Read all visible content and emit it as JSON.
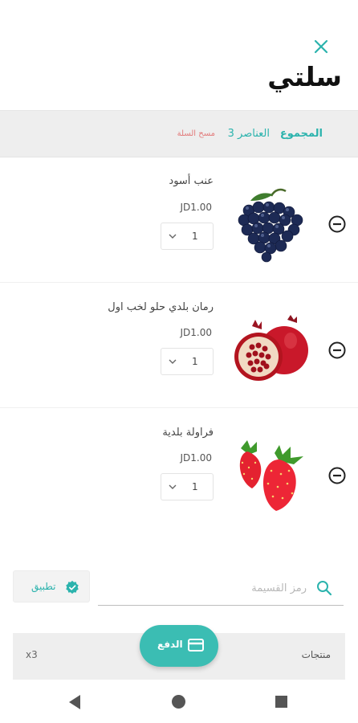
{
  "header": {
    "title": "سلتي"
  },
  "summary": {
    "total_label": "المجموع",
    "count_text": "3 العناصر",
    "clear_label": "مسح السلة"
  },
  "items": [
    {
      "name": "عنب أسود",
      "price": "JD1.00",
      "quantity": "1"
    },
    {
      "name": "رمان بلدي حلو لخب اول",
      "price": "JD1.00",
      "quantity": "1"
    },
    {
      "name": "فراولة بلدية",
      "price": "JD1.00",
      "quantity": "1"
    }
  ],
  "coupon": {
    "placeholder": "رمز القسيمة",
    "apply_label": "تطبيق"
  },
  "checkout": {
    "pay_label": "الدفع",
    "products_label": "منتجات",
    "count_text": "x3"
  },
  "colors": {
    "accent": "#3bbdb3",
    "danger": "#e27a7a"
  }
}
